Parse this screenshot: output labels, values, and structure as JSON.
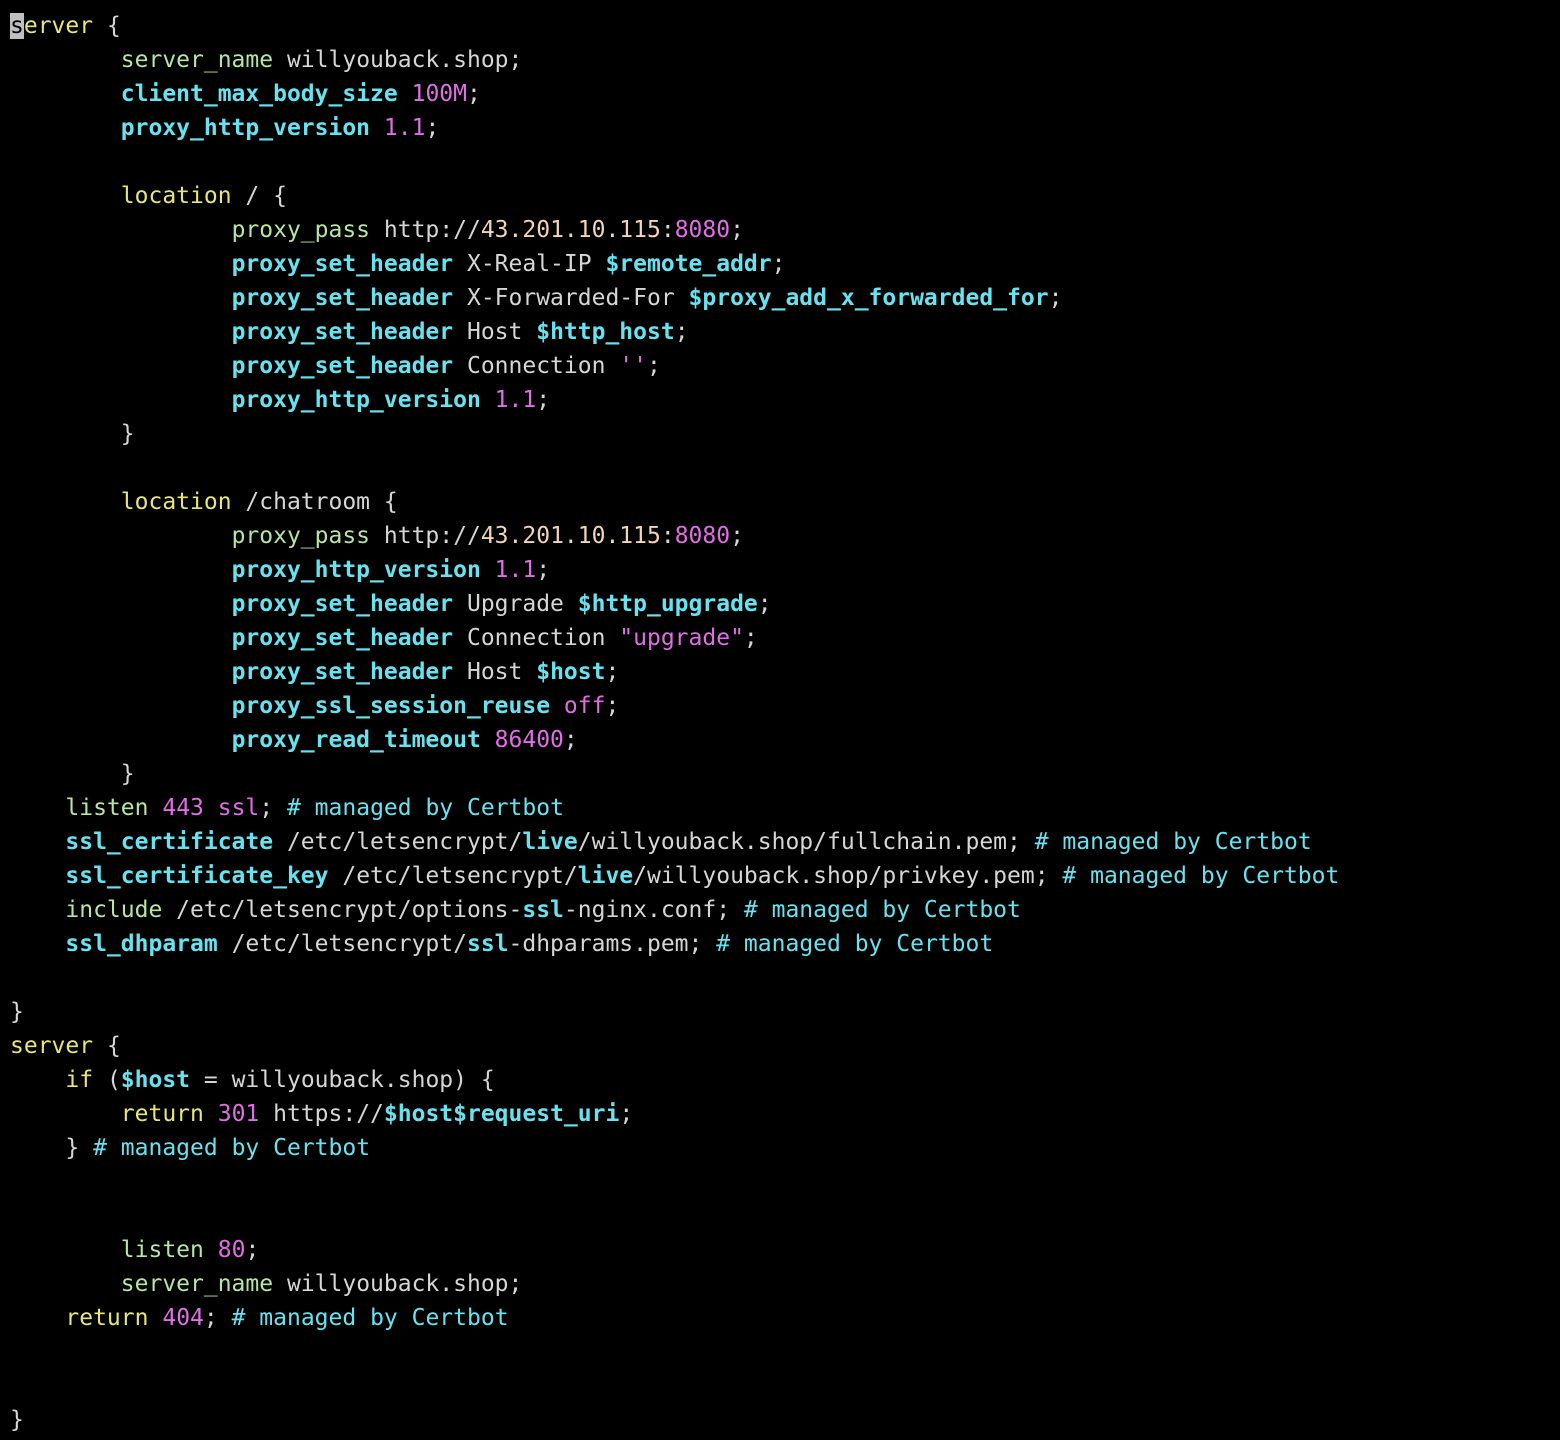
{
  "editor": {
    "cursor_char": "s",
    "colors": {
      "background": "#000000",
      "keyword": "#e8e57a",
      "directive": "#b7e5a3",
      "directive_bold": "#69e2f0",
      "variable": "#69e2f0",
      "number": "#e06ee4",
      "comment": "#69e2f0",
      "ip": "#f2d5b4",
      "plain": "#d6d6d6"
    },
    "lines": [
      [
        {
          "t": "s",
          "c": "cursor"
        },
        {
          "t": "erver",
          "c": "keyword"
        },
        {
          "t": " {",
          "c": "plain"
        }
      ],
      [
        {
          "t": "        ",
          "c": "plain"
        },
        {
          "t": "server_name",
          "c": "directive"
        },
        {
          "t": " willyouback.shop;",
          "c": "plain"
        }
      ],
      [
        {
          "t": "        ",
          "c": "plain"
        },
        {
          "t": "client_max_body_size",
          "c": "directive-bold"
        },
        {
          "t": " ",
          "c": "plain"
        },
        {
          "t": "100M",
          "c": "number"
        },
        {
          "t": ";",
          "c": "plain"
        }
      ],
      [
        {
          "t": "        ",
          "c": "plain"
        },
        {
          "t": "proxy_http_version",
          "c": "directive-bold"
        },
        {
          "t": " ",
          "c": "plain"
        },
        {
          "t": "1.1",
          "c": "number"
        },
        {
          "t": ";",
          "c": "plain"
        }
      ],
      [],
      [
        {
          "t": "        ",
          "c": "plain"
        },
        {
          "t": "location",
          "c": "keyword"
        },
        {
          "t": " / {",
          "c": "plain"
        }
      ],
      [
        {
          "t": "                ",
          "c": "plain"
        },
        {
          "t": "proxy_pass",
          "c": "directive"
        },
        {
          "t": " http://",
          "c": "plain"
        },
        {
          "t": "43.201.10.115",
          "c": "ip"
        },
        {
          "t": ":",
          "c": "plain"
        },
        {
          "t": "8080",
          "c": "number"
        },
        {
          "t": ";",
          "c": "plain"
        }
      ],
      [
        {
          "t": "                ",
          "c": "plain"
        },
        {
          "t": "proxy_set_header",
          "c": "directive-bold"
        },
        {
          "t": " X-Real-IP ",
          "c": "plain"
        },
        {
          "t": "$remote_addr",
          "c": "variable"
        },
        {
          "t": ";",
          "c": "plain"
        }
      ],
      [
        {
          "t": "                ",
          "c": "plain"
        },
        {
          "t": "proxy_set_header",
          "c": "directive-bold"
        },
        {
          "t": " X-Forwarded-For ",
          "c": "plain"
        },
        {
          "t": "$proxy_add_x_forwarded_for",
          "c": "variable"
        },
        {
          "t": ";",
          "c": "plain"
        }
      ],
      [
        {
          "t": "                ",
          "c": "plain"
        },
        {
          "t": "proxy_set_header",
          "c": "directive-bold"
        },
        {
          "t": " Host ",
          "c": "plain"
        },
        {
          "t": "$http_host",
          "c": "variable"
        },
        {
          "t": ";",
          "c": "plain"
        }
      ],
      [
        {
          "t": "                ",
          "c": "plain"
        },
        {
          "t": "proxy_set_header",
          "c": "directive-bold"
        },
        {
          "t": " Connection ",
          "c": "plain"
        },
        {
          "t": "''",
          "c": "string"
        },
        {
          "t": ";",
          "c": "plain"
        }
      ],
      [
        {
          "t": "                ",
          "c": "plain"
        },
        {
          "t": "proxy_http_version",
          "c": "directive-bold"
        },
        {
          "t": " ",
          "c": "plain"
        },
        {
          "t": "1.1",
          "c": "number"
        },
        {
          "t": ";",
          "c": "plain"
        }
      ],
      [
        {
          "t": "        }",
          "c": "plain"
        }
      ],
      [],
      [
        {
          "t": "        ",
          "c": "plain"
        },
        {
          "t": "location",
          "c": "keyword"
        },
        {
          "t": " /chatroom {",
          "c": "plain"
        }
      ],
      [
        {
          "t": "                ",
          "c": "plain"
        },
        {
          "t": "proxy_pass",
          "c": "directive"
        },
        {
          "t": " http://",
          "c": "plain"
        },
        {
          "t": "43.201.10.115",
          "c": "ip"
        },
        {
          "t": ":",
          "c": "plain"
        },
        {
          "t": "8080",
          "c": "number"
        },
        {
          "t": ";",
          "c": "plain"
        }
      ],
      [
        {
          "t": "                ",
          "c": "plain"
        },
        {
          "t": "proxy_http_version",
          "c": "directive-bold"
        },
        {
          "t": " ",
          "c": "plain"
        },
        {
          "t": "1.1",
          "c": "number"
        },
        {
          "t": ";",
          "c": "plain"
        }
      ],
      [
        {
          "t": "                ",
          "c": "plain"
        },
        {
          "t": "proxy_set_header",
          "c": "directive-bold"
        },
        {
          "t": " Upgrade ",
          "c": "plain"
        },
        {
          "t": "$http_upgrade",
          "c": "variable"
        },
        {
          "t": ";",
          "c": "plain"
        }
      ],
      [
        {
          "t": "                ",
          "c": "plain"
        },
        {
          "t": "proxy_set_header",
          "c": "directive-bold"
        },
        {
          "t": " Connection ",
          "c": "plain"
        },
        {
          "t": "\"upgrade\"",
          "c": "string"
        },
        {
          "t": ";",
          "c": "plain"
        }
      ],
      [
        {
          "t": "                ",
          "c": "plain"
        },
        {
          "t": "proxy_set_header",
          "c": "directive-bold"
        },
        {
          "t": " Host ",
          "c": "plain"
        },
        {
          "t": "$host",
          "c": "variable"
        },
        {
          "t": ";",
          "c": "plain"
        }
      ],
      [
        {
          "t": "                ",
          "c": "plain"
        },
        {
          "t": "proxy_ssl_session_reuse",
          "c": "directive-bold"
        },
        {
          "t": " ",
          "c": "plain"
        },
        {
          "t": "off",
          "c": "number"
        },
        {
          "t": ";",
          "c": "plain"
        }
      ],
      [
        {
          "t": "                ",
          "c": "plain"
        },
        {
          "t": "proxy_read_timeout",
          "c": "directive-bold"
        },
        {
          "t": " ",
          "c": "plain"
        },
        {
          "t": "86400",
          "c": "number"
        },
        {
          "t": ";",
          "c": "plain"
        }
      ],
      [
        {
          "t": "        }",
          "c": "plain"
        }
      ],
      [
        {
          "t": "    ",
          "c": "plain"
        },
        {
          "t": "listen",
          "c": "directive"
        },
        {
          "t": " ",
          "c": "plain"
        },
        {
          "t": "443 ssl",
          "c": "number"
        },
        {
          "t": "; ",
          "c": "plain"
        },
        {
          "t": "# managed by Certbot",
          "c": "comment"
        }
      ],
      [
        {
          "t": "    ",
          "c": "plain"
        },
        {
          "t": "ssl_certificate",
          "c": "directive-bold"
        },
        {
          "t": " /etc/letsencrypt/",
          "c": "plain"
        },
        {
          "t": "live",
          "c": "variable"
        },
        {
          "t": "/willyouback.shop/fullchain.pem; ",
          "c": "plain"
        },
        {
          "t": "# managed by Certbot",
          "c": "comment"
        }
      ],
      [
        {
          "t": "    ",
          "c": "plain"
        },
        {
          "t": "ssl_certificate_key",
          "c": "directive-bold"
        },
        {
          "t": " /etc/letsencrypt/",
          "c": "plain"
        },
        {
          "t": "live",
          "c": "variable"
        },
        {
          "t": "/willyouback.shop/privkey.pem; ",
          "c": "plain"
        },
        {
          "t": "# managed by Certbot",
          "c": "comment"
        }
      ],
      [
        {
          "t": "    ",
          "c": "plain"
        },
        {
          "t": "include",
          "c": "directive"
        },
        {
          "t": " /etc/letsencrypt/options-",
          "c": "plain"
        },
        {
          "t": "ssl",
          "c": "variable"
        },
        {
          "t": "-nginx.conf; ",
          "c": "plain"
        },
        {
          "t": "# managed by Certbot",
          "c": "comment"
        }
      ],
      [
        {
          "t": "    ",
          "c": "plain"
        },
        {
          "t": "ssl_dhparam",
          "c": "directive-bold"
        },
        {
          "t": " /etc/letsencrypt/",
          "c": "plain"
        },
        {
          "t": "ssl",
          "c": "variable"
        },
        {
          "t": "-dhparams.pem; ",
          "c": "plain"
        },
        {
          "t": "# managed by Certbot",
          "c": "comment"
        }
      ],
      [],
      [
        {
          "t": "}",
          "c": "plain"
        }
      ],
      [
        {
          "t": "server",
          "c": "keyword"
        },
        {
          "t": " {",
          "c": "plain"
        }
      ],
      [
        {
          "t": "    ",
          "c": "plain"
        },
        {
          "t": "if",
          "c": "keyword"
        },
        {
          "t": " (",
          "c": "plain"
        },
        {
          "t": "$host",
          "c": "variable"
        },
        {
          "t": " = willyouback.shop) {",
          "c": "plain"
        }
      ],
      [
        {
          "t": "        ",
          "c": "plain"
        },
        {
          "t": "return",
          "c": "keyword"
        },
        {
          "t": " ",
          "c": "plain"
        },
        {
          "t": "301",
          "c": "number"
        },
        {
          "t": " https://",
          "c": "plain"
        },
        {
          "t": "$host$request_uri",
          "c": "variable"
        },
        {
          "t": ";",
          "c": "plain"
        }
      ],
      [
        {
          "t": "    } ",
          "c": "plain"
        },
        {
          "t": "# managed by Certbot",
          "c": "comment"
        }
      ],
      [],
      [],
      [
        {
          "t": "        ",
          "c": "plain"
        },
        {
          "t": "listen",
          "c": "directive"
        },
        {
          "t": " ",
          "c": "plain"
        },
        {
          "t": "80",
          "c": "number"
        },
        {
          "t": ";",
          "c": "plain"
        }
      ],
      [
        {
          "t": "        ",
          "c": "plain"
        },
        {
          "t": "server_name",
          "c": "directive"
        },
        {
          "t": " willyouback.shop;",
          "c": "plain"
        }
      ],
      [
        {
          "t": "    ",
          "c": "plain"
        },
        {
          "t": "return",
          "c": "keyword"
        },
        {
          "t": " ",
          "c": "plain"
        },
        {
          "t": "404",
          "c": "number"
        },
        {
          "t": "; ",
          "c": "plain"
        },
        {
          "t": "# managed by Certbot",
          "c": "comment"
        }
      ],
      [],
      [],
      [
        {
          "t": "}",
          "c": "plain"
        }
      ]
    ]
  }
}
